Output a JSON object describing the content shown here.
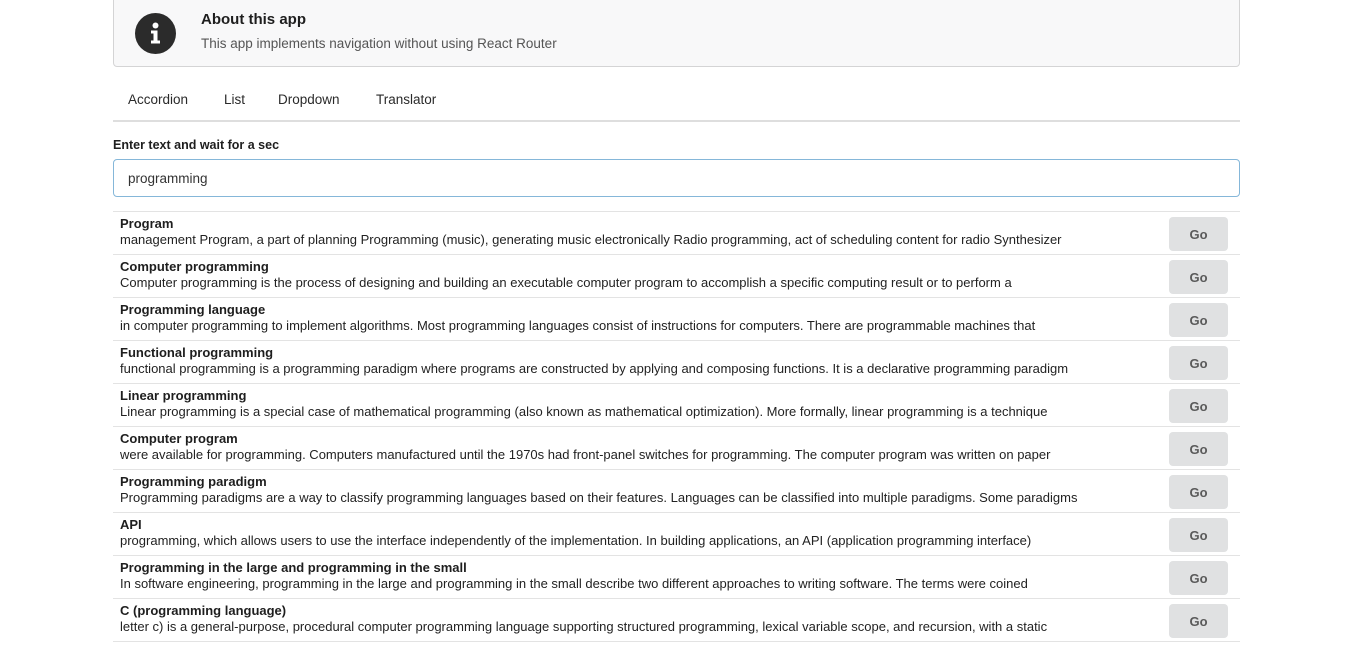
{
  "about": {
    "title": "About this app",
    "text": "This app implements navigation without using React Router",
    "icon": "info-icon"
  },
  "menu": {
    "items": [
      {
        "label": "Accordion"
      },
      {
        "label": "List"
      },
      {
        "label": "Dropdown"
      },
      {
        "label": "Translator"
      }
    ]
  },
  "search": {
    "label": "Enter text and wait for a sec",
    "value": "programming"
  },
  "results": [
    {
      "title": "Program",
      "snippet": "management Program, a part of planning Programming (music), generating music electronically Radio programming, act of scheduling content for radio Synthesizer",
      "button": "Go"
    },
    {
      "title": "Computer programming",
      "snippet": "Computer programming is the process of designing and building an executable computer program to accomplish a specific computing result or to perform a",
      "button": "Go"
    },
    {
      "title": "Programming language",
      "snippet": "in computer programming to implement algorithms. Most programming languages consist of instructions for computers. There are programmable machines that",
      "button": "Go"
    },
    {
      "title": "Functional programming",
      "snippet": "functional programming is a programming paradigm where programs are constructed by applying and composing functions. It is a declarative programming paradigm",
      "button": "Go"
    },
    {
      "title": "Linear programming",
      "snippet": "Linear programming is a special case of mathematical programming (also known as mathematical optimization). More formally, linear programming is a technique",
      "button": "Go"
    },
    {
      "title": "Computer program",
      "snippet": "were available for programming. Computers manufactured until the 1970s had front-panel switches for programming. The computer program was written on paper",
      "button": "Go"
    },
    {
      "title": "Programming paradigm",
      "snippet": "Programming paradigms are a way to classify programming languages based on their features. Languages can be classified into multiple paradigms. Some paradigms",
      "button": "Go"
    },
    {
      "title": "API",
      "snippet": "programming, which allows users to use the interface independently of the implementation. In building applications, an API (application programming interface)",
      "button": "Go"
    },
    {
      "title": "Programming in the large and programming in the small",
      "snippet": "In software engineering, programming in the large and programming in the small describe two different approaches to writing software. The terms were coined",
      "button": "Go"
    },
    {
      "title": "C (programming language)",
      "snippet": "letter c) is a general-purpose, procedural computer programming language supporting structured programming, lexical variable scope, and recursion, with a static",
      "button": "Go"
    }
  ]
}
